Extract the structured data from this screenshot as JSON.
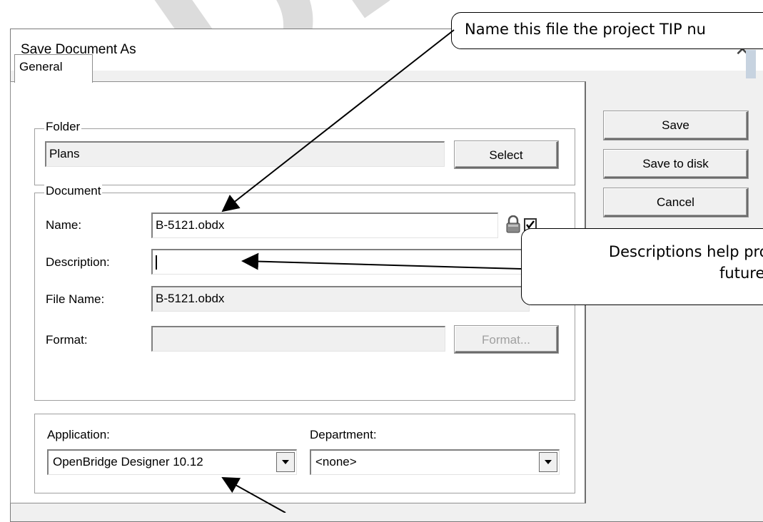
{
  "watermark": "DRA",
  "dialog": {
    "title": "Save Document As",
    "close": "✕",
    "tab": "General",
    "folder": {
      "legend": "Folder",
      "value": "Plans",
      "select_button": "Select"
    },
    "document": {
      "legend": "Document",
      "name_label": "Name:",
      "name_value": "B-5121.obdx",
      "description_label": "Description:",
      "description_value": "",
      "filename_label": "File Name:",
      "filename_value": "B-5121.obdx",
      "format_label": "Format:",
      "format_value": "",
      "format_button": "Format..."
    },
    "application": {
      "label": "Application:",
      "value": "OpenBridge Designer 10.12"
    },
    "department": {
      "label": "Department:",
      "value": "<none>"
    },
    "buttons": {
      "save": "Save",
      "save_to_disk": "Save to disk",
      "cancel": "Cancel"
    }
  },
  "callouts": {
    "name_tip": "Name this file the project TIP nu",
    "description_tip_line1": "Descriptions help prov",
    "description_tip_line2": "future s"
  },
  "colors": {
    "dialog_bg": "#f0f0f0",
    "panel_bg": "#ffffff",
    "watermark": "#d9d9d9"
  }
}
